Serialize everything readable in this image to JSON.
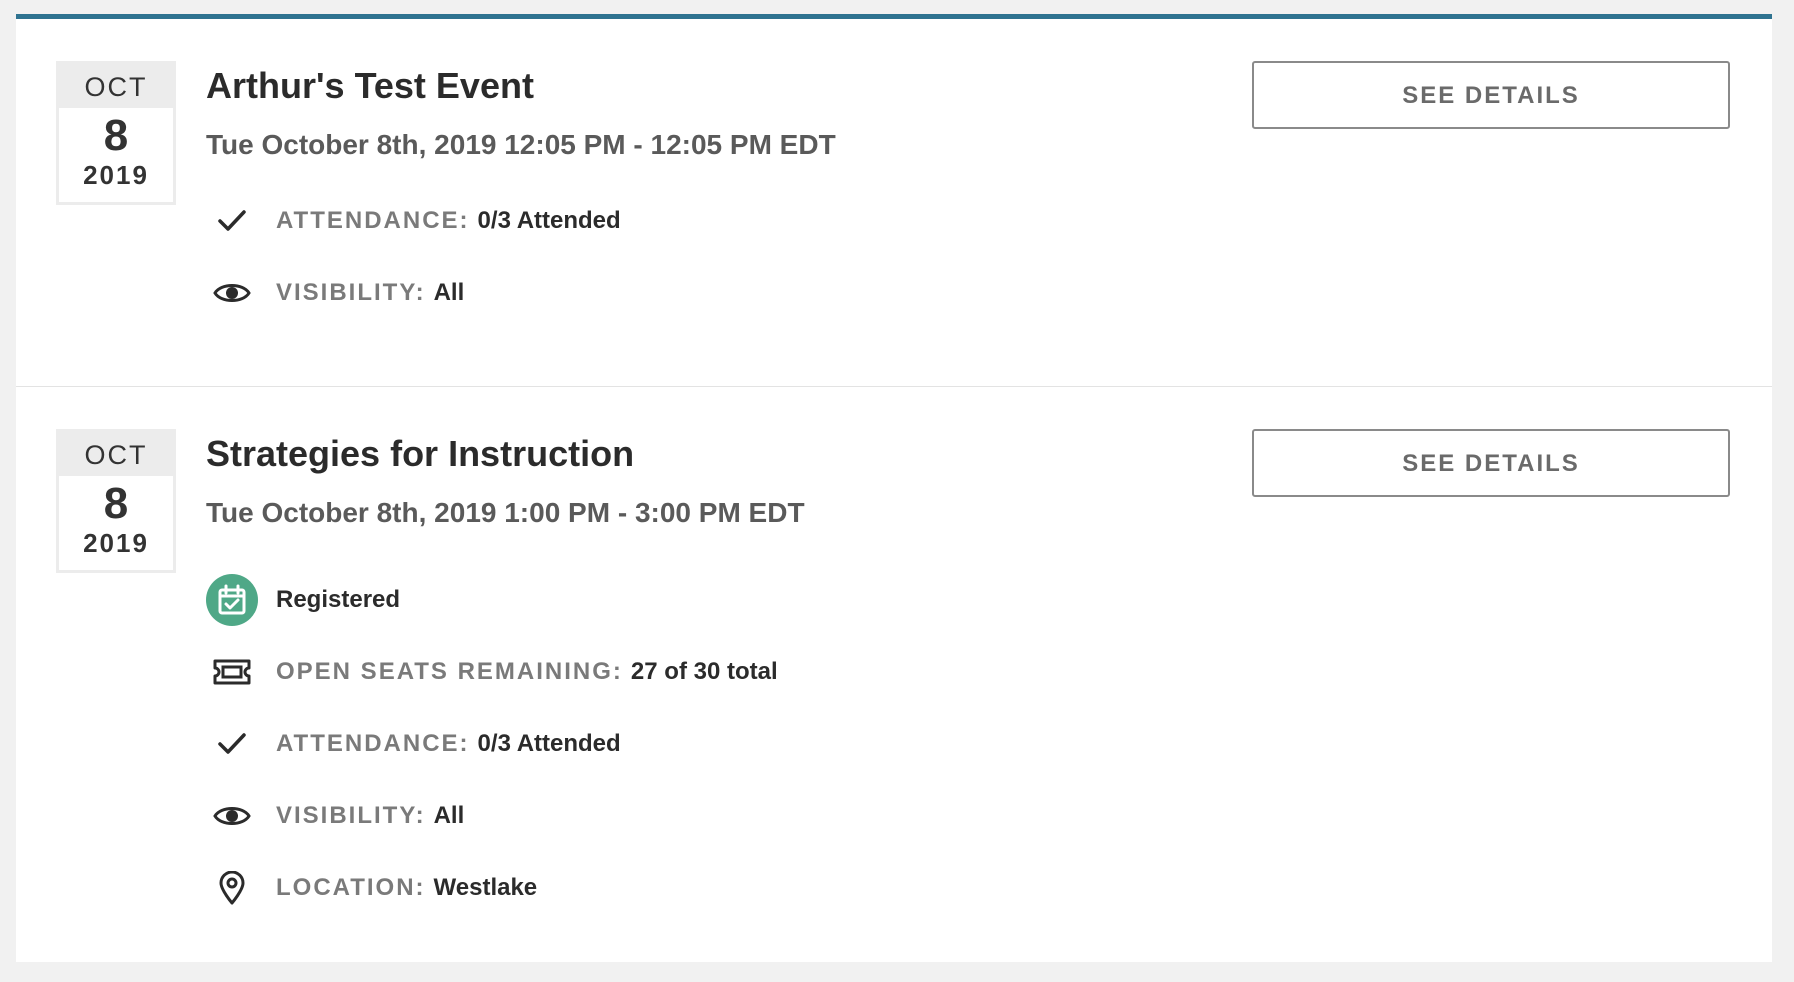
{
  "events": [
    {
      "month": "OCT",
      "day": "8",
      "year": "2019",
      "title": "Arthur's Test Event",
      "datetime": "Tue October 8th, 2019 12:05 PM - 12:05 PM EDT",
      "details_label": "SEE DETAILS",
      "attendance": {
        "label": "ATTENDANCE:",
        "value": "0/3 Attended"
      },
      "visibility": {
        "label": "VISIBILITY:",
        "value": "All"
      }
    },
    {
      "month": "OCT",
      "day": "8",
      "year": "2019",
      "title": "Strategies for Instruction",
      "datetime": "Tue October 8th, 2019 1:00 PM - 3:00 PM EDT",
      "details_label": "SEE DETAILS",
      "registered": "Registered",
      "seats": {
        "label": "OPEN SEATS REMAINING:",
        "value": "27 of 30 total"
      },
      "attendance": {
        "label": "ATTENDANCE:",
        "value": "0/3 Attended"
      },
      "visibility": {
        "label": "VISIBILITY:",
        "value": "All"
      },
      "location": {
        "label": "LOCATION:",
        "value": "Westlake"
      }
    }
  ],
  "colors": {
    "accent_bar": "#2f7390",
    "registered_badge": "#4fa887"
  },
  "icons": [
    "check-icon",
    "eye-icon",
    "calendar-check-icon",
    "ticket-icon",
    "map-pin-icon"
  ]
}
